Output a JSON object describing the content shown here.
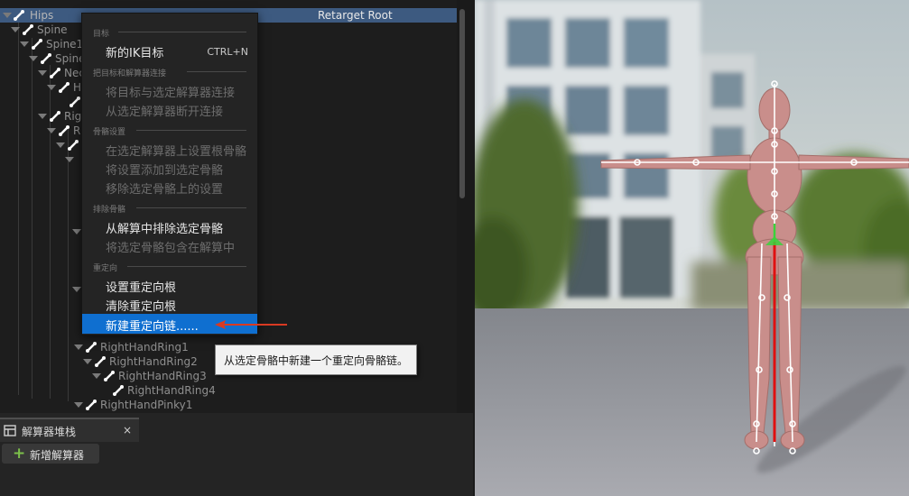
{
  "tree": {
    "root_label": "Hips",
    "retarget_root_label": "Retarget Root",
    "bones": [
      {
        "label": "Spine"
      },
      {
        "label": "Spine1"
      },
      {
        "label": "Spine"
      },
      {
        "label": "Nec"
      },
      {
        "label": "H"
      },
      {
        "label": "Rig"
      },
      {
        "label": "Ri"
      },
      {
        "label": "RightHandRing1"
      },
      {
        "label": "RightHandRing2"
      },
      {
        "label": "RightHandRing3"
      },
      {
        "label": "RightHandRing4"
      },
      {
        "label": "RightHandPinky1"
      }
    ]
  },
  "context_menu": {
    "sections": [
      {
        "title": "目标",
        "items": [
          {
            "label": "新的IK目标",
            "shortcut": "CTRL+N",
            "enabled": true
          }
        ]
      },
      {
        "title": "把目标和解算器连接",
        "items": [
          {
            "label": "将目标与选定解算器连接",
            "enabled": false
          },
          {
            "label": "从选定解算器断开连接",
            "enabled": false
          }
        ]
      },
      {
        "title": "骨骼设置",
        "items": [
          {
            "label": "在选定解算器上设置根骨骼",
            "enabled": false
          },
          {
            "label": "将设置添加到选定骨骼",
            "enabled": false
          },
          {
            "label": "移除选定骨骼上的设置",
            "enabled": false
          }
        ]
      },
      {
        "title": "排除骨骼",
        "items": [
          {
            "label": "从解算中排除选定骨骼",
            "enabled": true
          },
          {
            "label": "将选定骨骼包含在解算中",
            "enabled": false
          }
        ]
      },
      {
        "title": "重定向",
        "items": [
          {
            "label": "设置重定向根",
            "enabled": true
          },
          {
            "label": "清除重定向根",
            "enabled": true
          },
          {
            "label": "新建重定向链......",
            "enabled": true,
            "highlighted": true
          }
        ]
      }
    ]
  },
  "tooltip": {
    "text": "从选定骨骼中新建一个重定向骨骼链。"
  },
  "solver_panel": {
    "tab_label": "解算器堆栈",
    "close_glyph": "×",
    "add_button_label": "新增解算器",
    "add_button_icon": "+"
  },
  "colors": {
    "highlight": "#0f6fd0",
    "arrow": "#d93a22",
    "chain_red": "#e01010",
    "chain_green": "#3bd13b"
  }
}
